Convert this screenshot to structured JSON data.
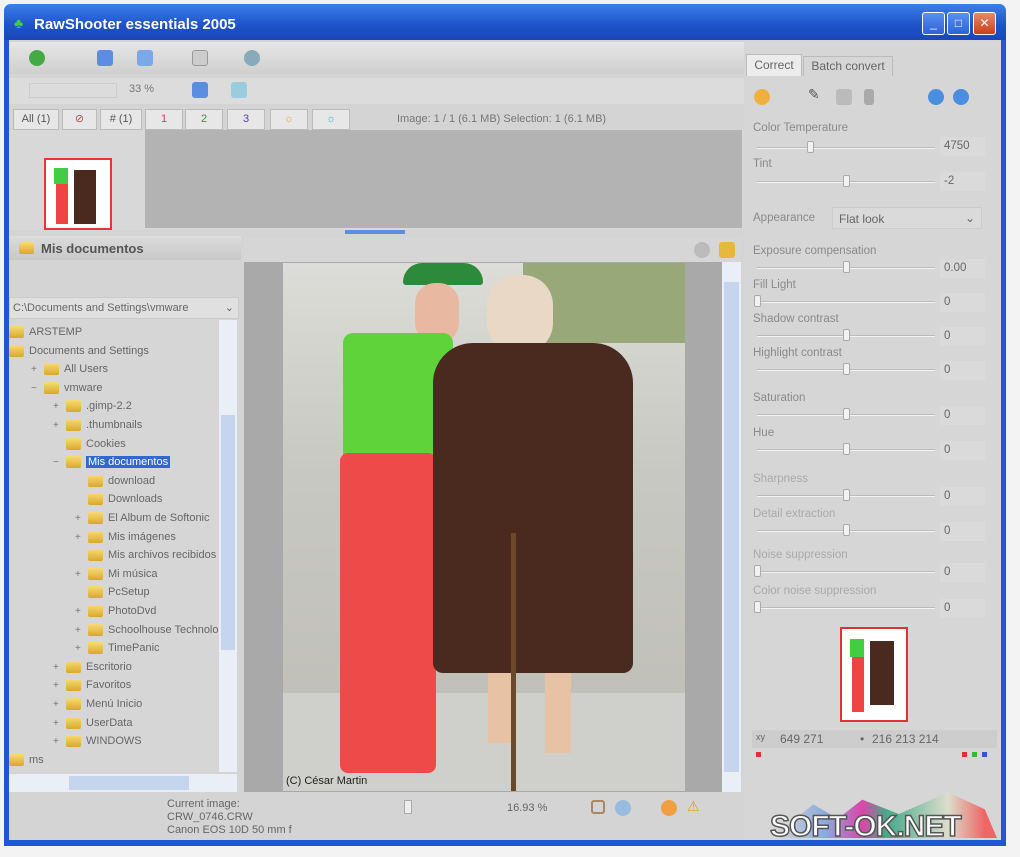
{
  "window": {
    "title": "RawShooter essentials 2005",
    "minimize": "_",
    "maximize": "□",
    "close": "✕"
  },
  "toolbar": {
    "zoom_value": "33 %",
    "status": "Image: 1 / 1 (6.1 MB) Selection: 1 (6.1 MB)"
  },
  "filter_tabs": [
    {
      "label": "All (1)",
      "color": "#555"
    },
    {
      "label": "⊘",
      "color": "#a55"
    },
    {
      "label": "# (1)",
      "color": "#555"
    },
    {
      "label": "1",
      "color": "#d04060"
    },
    {
      "label": "2",
      "color": "#3a9a3a"
    },
    {
      "label": "3",
      "color": "#6040b0"
    },
    {
      "label": "☼",
      "color": "#e0b020"
    },
    {
      "label": "☼",
      "color": "#40b0c0"
    }
  ],
  "folders": {
    "header": "Mis documentos",
    "path": "C:\\Documents and Settings\\vmware",
    "tree": [
      {
        "label": "ARSTEMP",
        "level": 0,
        "exp": ""
      },
      {
        "label": "Documents and Settings",
        "level": 0,
        "exp": ""
      },
      {
        "label": "All Users",
        "level": 1,
        "exp": "+"
      },
      {
        "label": "vmware",
        "level": 1,
        "exp": "−"
      },
      {
        "label": ".gimp-2.2",
        "level": 2,
        "exp": "+"
      },
      {
        "label": ".thumbnails",
        "level": 2,
        "exp": "+"
      },
      {
        "label": "Cookies",
        "level": 2,
        "exp": ""
      },
      {
        "label": "Mis documentos",
        "level": 2,
        "exp": "−",
        "selected": true
      },
      {
        "label": "download",
        "level": 3,
        "exp": ""
      },
      {
        "label": "Downloads",
        "level": 3,
        "exp": ""
      },
      {
        "label": "El Album de Softonic",
        "level": 3,
        "exp": "+"
      },
      {
        "label": "Mis imágenes",
        "level": 3,
        "exp": "+"
      },
      {
        "label": "Mis archivos recibidos",
        "level": 3,
        "exp": ""
      },
      {
        "label": "Mi música",
        "level": 3,
        "exp": "+"
      },
      {
        "label": "PcSetup",
        "level": 3,
        "exp": ""
      },
      {
        "label": "PhotoDvd",
        "level": 3,
        "exp": "+"
      },
      {
        "label": "Schoolhouse Technolo",
        "level": 3,
        "exp": "+"
      },
      {
        "label": "TimePanic",
        "level": 3,
        "exp": "+"
      },
      {
        "label": "Escritorio",
        "level": 2,
        "exp": "+"
      },
      {
        "label": "Favoritos",
        "level": 2,
        "exp": "+"
      },
      {
        "label": "Menú Inicio",
        "level": 2,
        "exp": "+"
      },
      {
        "label": "UserData",
        "level": 2,
        "exp": "+"
      },
      {
        "label": "WINDOWS",
        "level": 2,
        "exp": "+"
      },
      {
        "label": "ms",
        "level": 0,
        "exp": ""
      }
    ]
  },
  "viewer": {
    "credit": "(C) César Martin"
  },
  "statusbar": {
    "current_label": "Current image:",
    "filename": "CRW_0746.CRW",
    "camera": "Canon EOS 10D  50 mm  f",
    "zoom": "16.93 %"
  },
  "panel": {
    "tabs": [
      "Correct",
      "Batch convert"
    ],
    "color_temperature": {
      "label": "Color Temperature",
      "value": "4750",
      "pos": 0.3
    },
    "tint": {
      "label": "Tint",
      "value": "-2",
      "pos": 0.5
    },
    "appearance": {
      "label": "Appearance",
      "value": "Flat look"
    },
    "sliders": [
      {
        "label": "Exposure compensation",
        "value": "0.00",
        "pos": 0.5
      },
      {
        "label": "Fill Light",
        "value": "0",
        "pos": 0
      },
      {
        "label": "Shadow contrast",
        "value": "0",
        "pos": 0.5
      },
      {
        "label": "Highlight contrast",
        "value": "0",
        "pos": 0.5
      },
      {
        "label": "Saturation",
        "value": "0",
        "pos": 0.5
      },
      {
        "label": "Hue",
        "value": "0",
        "pos": 0.5
      },
      {
        "label": "Sharpness",
        "value": "0",
        "pos": 0.5
      },
      {
        "label": "Detail extraction",
        "value": "0",
        "pos": 0.5
      },
      {
        "label": "Noise suppression",
        "value": "0",
        "pos": 0
      },
      {
        "label": "Color noise suppression",
        "value": "0",
        "pos": 0
      }
    ],
    "readout": {
      "xy": "649  271",
      "rgb": "216  213  214",
      "prefix": "xy"
    }
  },
  "watermark": "SOFT-OK.NET"
}
